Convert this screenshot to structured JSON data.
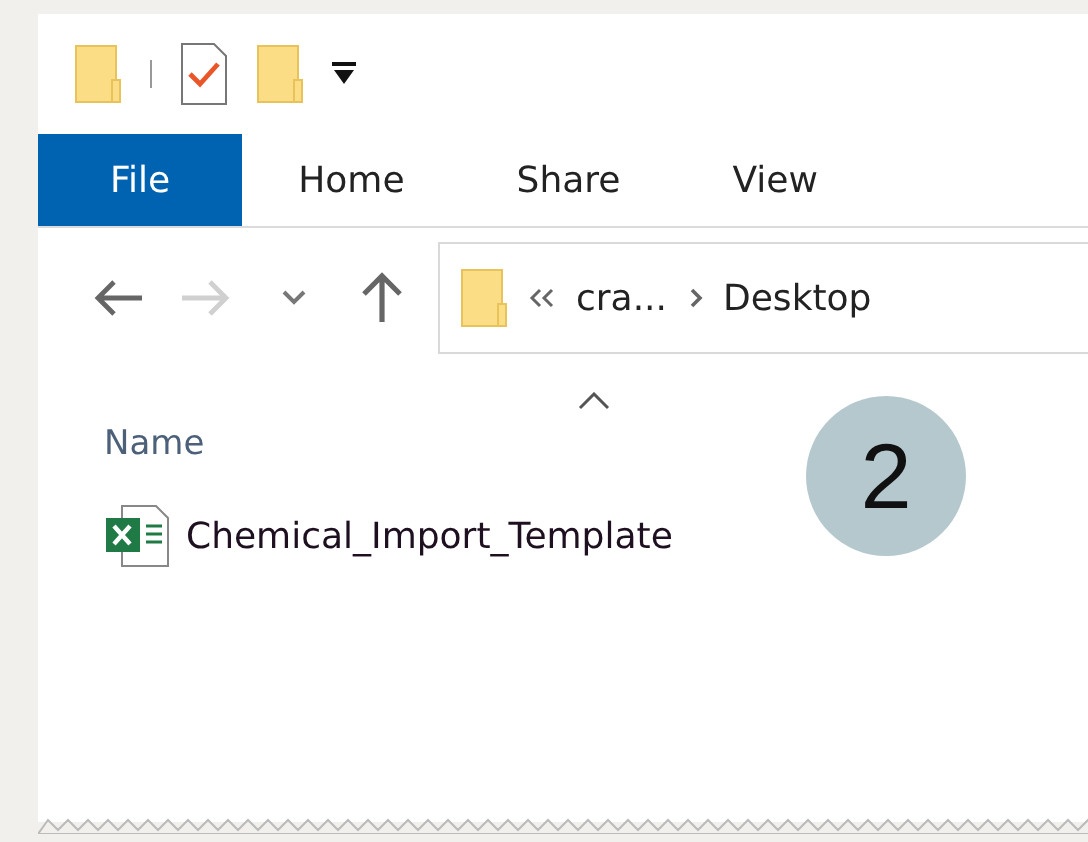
{
  "ribbon": {
    "tabs": [
      {
        "label": "File",
        "selected": true
      },
      {
        "label": "Home",
        "selected": false
      },
      {
        "label": "Share",
        "selected": false
      },
      {
        "label": "View",
        "selected": false
      }
    ]
  },
  "navigation": {
    "forward_disabled": true,
    "path": [
      {
        "label": "cra..."
      },
      {
        "label": "Desktop"
      }
    ]
  },
  "file_list": {
    "column": "Name",
    "files": [
      {
        "name": "Chemical_Import_Template",
        "kind": "spreadsheet"
      }
    ]
  },
  "step_badge": "2"
}
